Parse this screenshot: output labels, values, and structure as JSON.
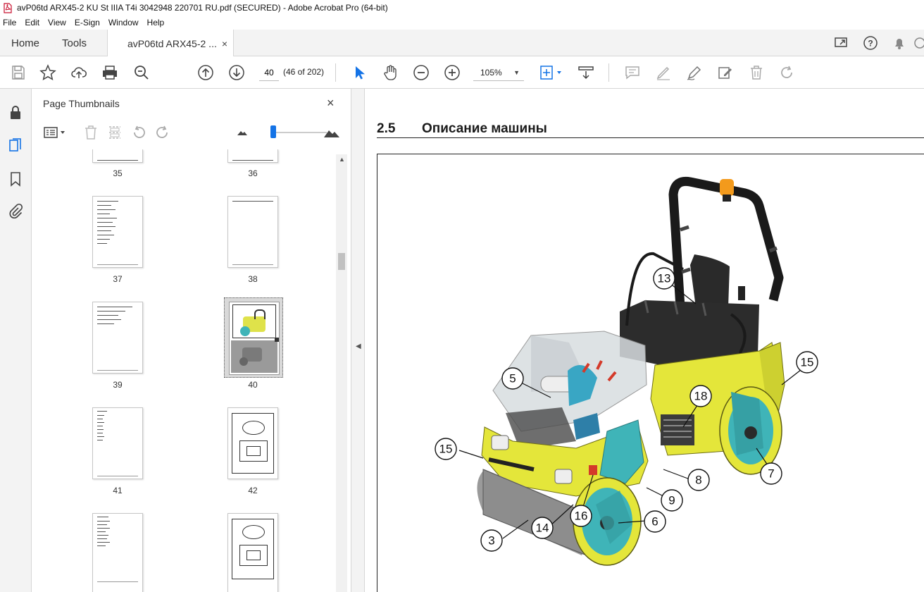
{
  "window": {
    "title": "avP06td ARX45-2 KU St IIIA T4i 3042948 220701 RU.pdf (SECURED) - Adobe Acrobat Pro (64-bit)"
  },
  "menu": [
    "File",
    "Edit",
    "View",
    "E-Sign",
    "Window",
    "Help"
  ],
  "tabs": {
    "home": "Home",
    "tools": "Tools",
    "document": "avP06td ARX45-2 ...",
    "close": "×"
  },
  "toolbar": {
    "page_number": "40",
    "page_count": "(46 of 202)",
    "zoom": "105%"
  },
  "thumbnails_panel": {
    "title": "Page Thumbnails",
    "close": "×",
    "pages": [
      {
        "label": "35"
      },
      {
        "label": "36"
      },
      {
        "label": "37"
      },
      {
        "label": "38"
      },
      {
        "label": "39"
      },
      {
        "label": "40",
        "selected": true
      },
      {
        "label": "41"
      },
      {
        "label": "42"
      },
      {
        "label": "",
        "note": "partial"
      },
      {
        "label": "",
        "note": "partial"
      }
    ]
  },
  "document": {
    "section_number": "2.5",
    "section_title": "Описание машины",
    "callouts": [
      "13",
      "5",
      "15",
      "18",
      "15",
      "7",
      "8",
      "9",
      "6",
      "16",
      "14",
      "3"
    ]
  },
  "colors": {
    "accent": "#1473e6",
    "machine_yellow": "#e4e63a",
    "machine_teal": "#3fb4b8",
    "beacon_orange": "#f39a1c"
  }
}
